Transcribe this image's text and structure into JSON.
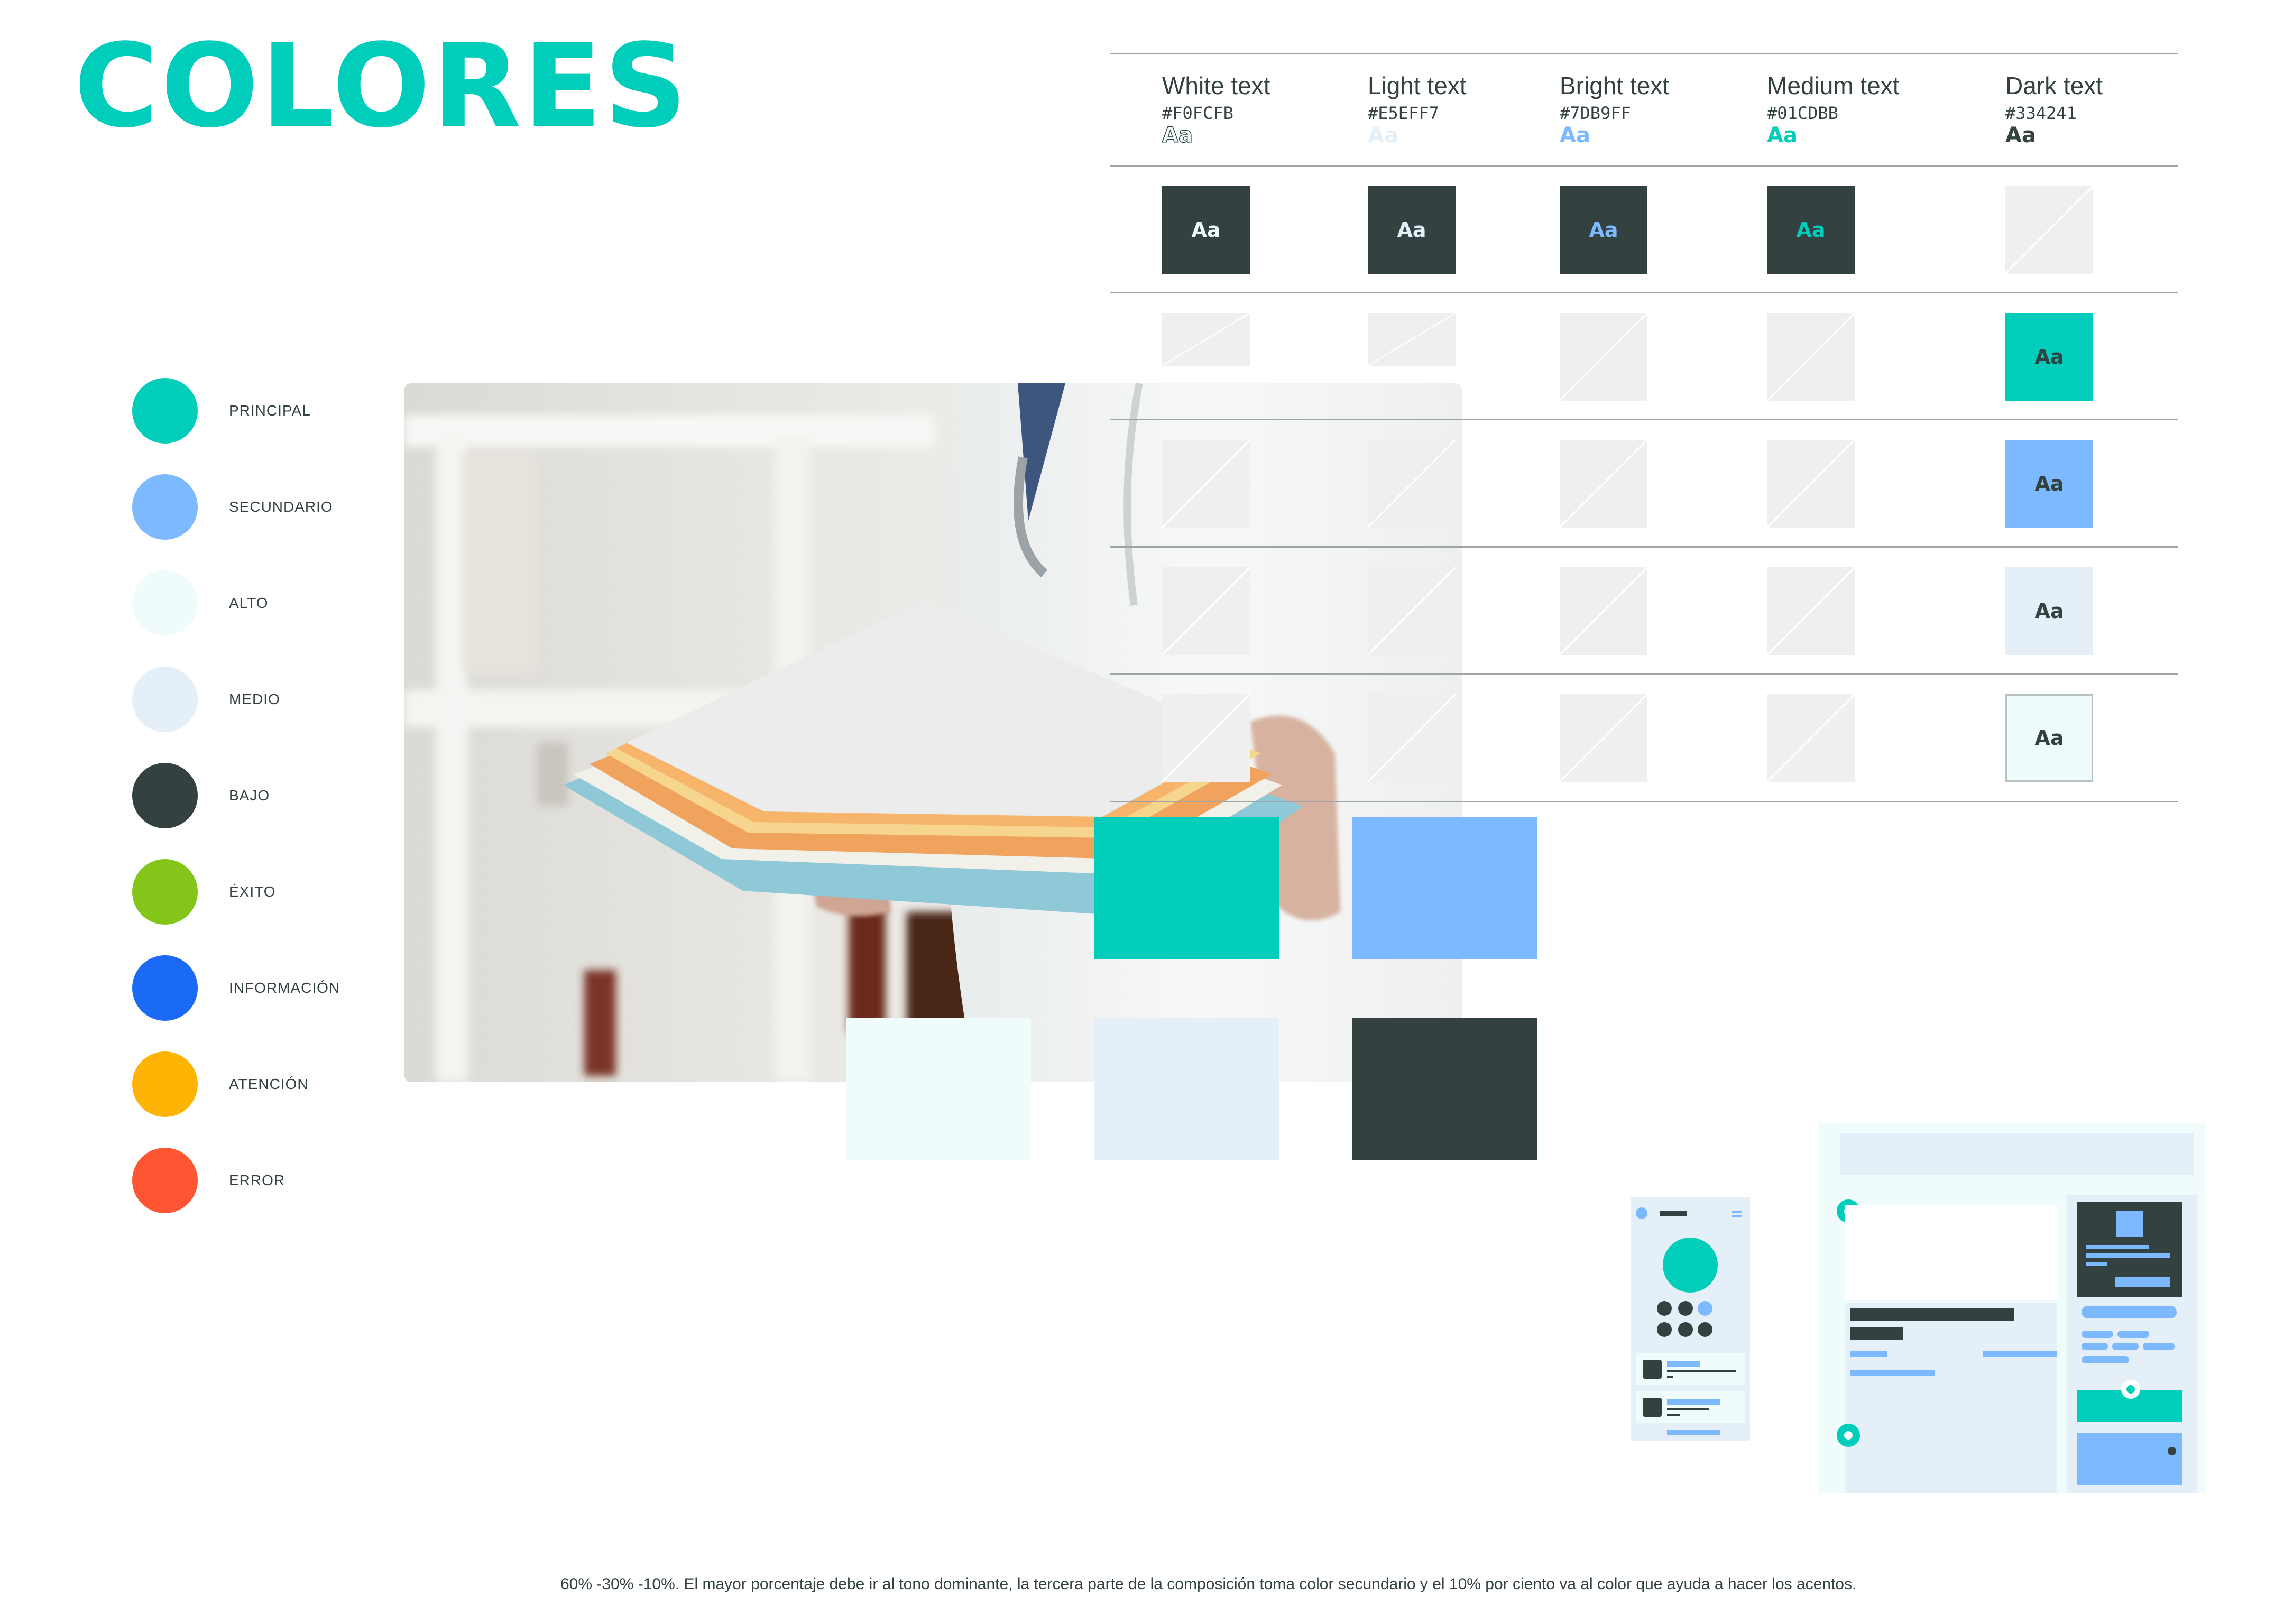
{
  "title": "COLORES",
  "colors": {
    "principal": "#01CDBB",
    "secundario": "#7DB9FF",
    "alto": "#F0FCFB",
    "medio": "#E5EFF7",
    "bajo": "#334241",
    "exito": "#84C51A",
    "informacion": "#1A6AF5",
    "atencion": "#FFB405",
    "error": "#FF5533"
  },
  "palette": [
    {
      "label": "PRINCIPAL",
      "color": "#01CDBB"
    },
    {
      "label": "SECUNDARIO",
      "color": "#7DB9FF"
    },
    {
      "label": "ALTO",
      "color": "#F0FCFB"
    },
    {
      "label": "MEDIO",
      "color": "#E5EFF7"
    },
    {
      "label": "BAJO",
      "color": "#334241"
    },
    {
      "label": "ÉXITO",
      "color": "#84C51A"
    },
    {
      "label": "INFORMACIÓN",
      "color": "#1A6AF5"
    },
    {
      "label": "ATENCIÓN",
      "color": "#FFB405"
    },
    {
      "label": "ERROR",
      "color": "#FF5533"
    }
  ],
  "contrast_table": {
    "sample": "Aa",
    "columns": [
      {
        "name": "White text",
        "hex": "#F0FCFB",
        "color": "#F0FCFB"
      },
      {
        "name": "Light text",
        "hex": "#E5EFF7",
        "color": "#E5EFF7"
      },
      {
        "name": "Bright text",
        "hex": "#7DB9FF",
        "color": "#7DB9FF"
      },
      {
        "name": "Medium text",
        "hex": "#01CDBB",
        "color": "#01CDBB"
      },
      {
        "name": "Dark text",
        "hex": "#334241",
        "color": "#334241"
      }
    ],
    "rows": [
      {
        "background": "#334241",
        "cells": [
          "ok",
          "ok",
          "ok",
          "ok",
          "na"
        ]
      },
      {
        "background": "#01CDBB",
        "cells": [
          "na",
          "na",
          "na",
          "na",
          "ok"
        ]
      },
      {
        "background": "#7DB9FF",
        "cells": [
          "na",
          "na",
          "na",
          "na",
          "ok"
        ]
      },
      {
        "background": "#E5EFF7",
        "cells": [
          "na",
          "na",
          "na",
          "na",
          "ok"
        ]
      },
      {
        "background": "#F0FCFB",
        "cells": [
          "na",
          "na",
          "na",
          "na",
          "ok"
        ]
      }
    ]
  },
  "swatches": [
    "#01CDBB",
    "#7DB9FF",
    "#F0FCFB",
    "#E5EFF7",
    "#334241"
  ],
  "hero_image": "doctor-holding-folders-photo",
  "footer_note": "60% -30% -10%. El mayor porcentaje debe ir al tono dominante, la tercera parte de la composición toma color secundario y el 10% por ciento va al color que ayuda a hacer los acentos."
}
